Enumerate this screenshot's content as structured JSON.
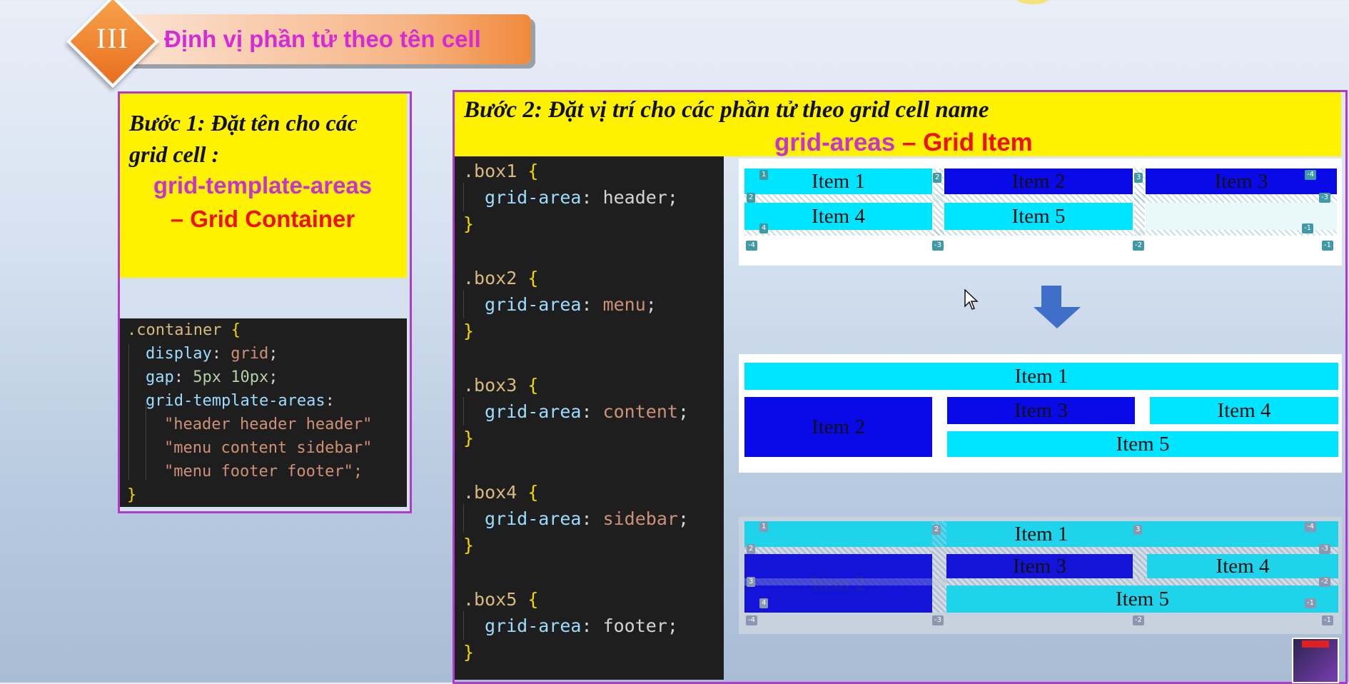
{
  "header": {
    "section_number": "III",
    "title": "Định vị phần tử theo tên cell"
  },
  "step1": {
    "heading_line1": "Bước 1:  Đặt tên cho các",
    "heading_line2": "grid cell :",
    "keyword": "grid-template-areas",
    "subject": "– Grid Container",
    "code": [
      ".container {",
      "display",
      ": ",
      "grid",
      ";",
      "gap",
      "5px 10px",
      "grid-template-areas",
      "\"header header header\"",
      "\"menu content sidebar\"",
      "\"menu footer footer\";",
      "}"
    ]
  },
  "step2": {
    "heading": "Bước 2:  Đặt vị trí cho các phần tử theo grid cell name",
    "keyword": "grid-areas",
    "subject": " – Grid Item",
    "rules": [
      {
        "selector": ".box1",
        "value": "header"
      },
      {
        "selector": ".box2",
        "value": "menu"
      },
      {
        "selector": ".box3",
        "value": "content"
      },
      {
        "selector": ".box4",
        "value": "sidebar"
      },
      {
        "selector": ".box5",
        "value": "footer"
      }
    ],
    "property": "grid-area"
  },
  "demo_before": {
    "items": [
      "Item 1",
      "Item 2",
      "Item 3",
      "Item 4",
      "Item 5"
    ],
    "line_top": [
      "1",
      "2",
      "3",
      "-4"
    ],
    "line_left": [
      "2",
      "4"
    ],
    "line_right": [
      "-3",
      "-1"
    ],
    "line_bottom": [
      "-4",
      "-3",
      "-2",
      "-1"
    ]
  },
  "demo_after": {
    "items": [
      "Item 1",
      "Item 2",
      "Item 3",
      "Item 4",
      "Item 5"
    ]
  },
  "demo_inspect": {
    "items": [
      "Item 1",
      "Item 2",
      "Item 3",
      "Item 4",
      "Item 5"
    ],
    "line_top": [
      "1",
      "2",
      "3",
      "-4"
    ],
    "line_left": [
      "2",
      "3",
      "4"
    ],
    "line_right": [
      "-3",
      "-2",
      "-1"
    ],
    "line_bottom": [
      "-4",
      "-3",
      "-2",
      "-1"
    ]
  },
  "colors": {
    "accent_magenta": "#c733d0",
    "accent_red": "#ee1111",
    "highlight_yellow": "#fff200",
    "item_cyan": "#00e5ff",
    "item_blue": "#0a0ae8"
  }
}
